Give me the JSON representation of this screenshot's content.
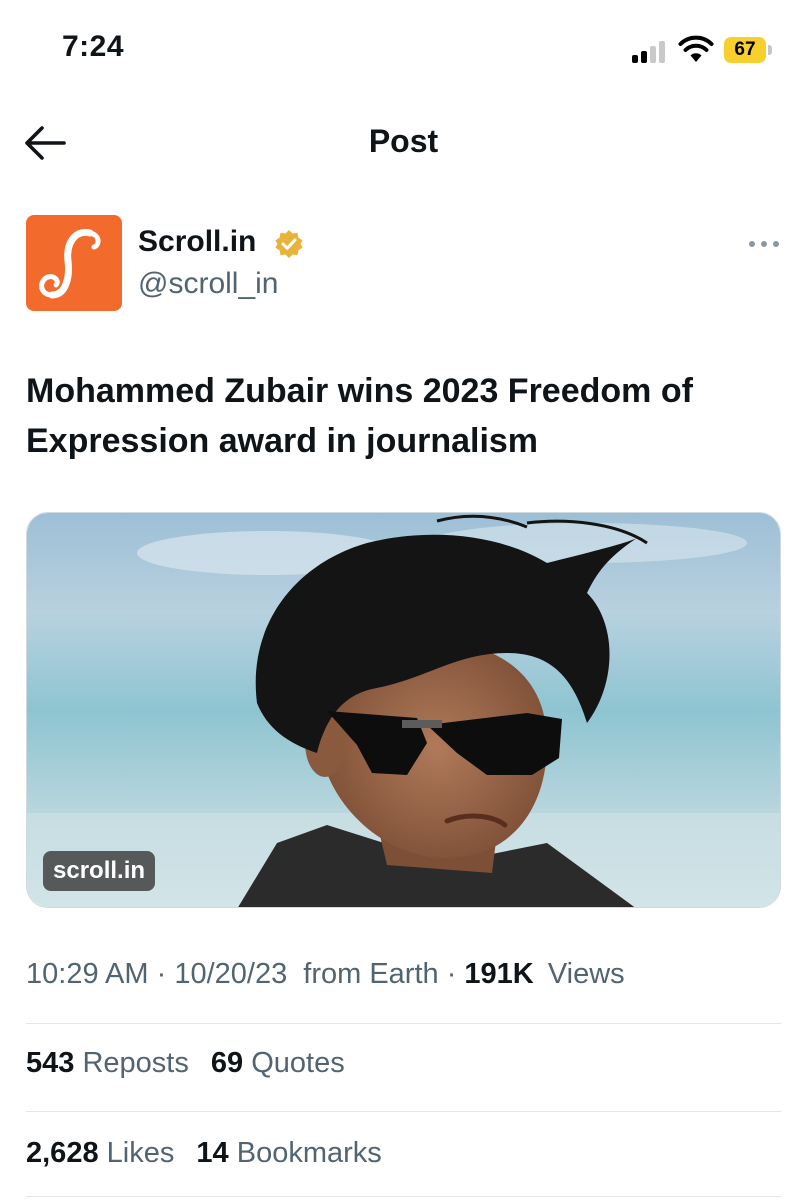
{
  "status_bar": {
    "time": "7:24",
    "battery_level": "67",
    "icons": [
      "cellular-signal-icon",
      "wifi-icon",
      "battery-icon"
    ],
    "battery_color": "#f7d02d"
  },
  "header": {
    "back_icon": "arrow-left-icon",
    "title": "Post"
  },
  "author": {
    "name": "Scroll.in",
    "handle": "@scroll_in",
    "verified": true,
    "verified_color": "#e8b33b",
    "avatar_color": "#f26a2c",
    "more_icon": "more-horizontal-icon"
  },
  "post": {
    "text": "Mohammed Zubair wins 2023 Freedom of Expression award in journalism",
    "link_card": {
      "domain": "scroll.in",
      "image": "photo of a man with sunglasses and windswept black hair against a sea background"
    }
  },
  "meta": {
    "time": "10:29 AM",
    "date": "10/20/23",
    "location": "from Earth",
    "views_count": "191K",
    "views_label": "Views"
  },
  "engagement": {
    "reposts_count": "543",
    "reposts_label": "Reposts",
    "quotes_count": "69",
    "quotes_label": "Quotes",
    "likes_count": "2,628",
    "likes_label": "Likes",
    "bookmarks_count": "14",
    "bookmarks_label": "Bookmarks"
  },
  "colors": {
    "text_primary": "#0f1419",
    "text_secondary": "#536471",
    "divider": "#e1e6e9"
  }
}
